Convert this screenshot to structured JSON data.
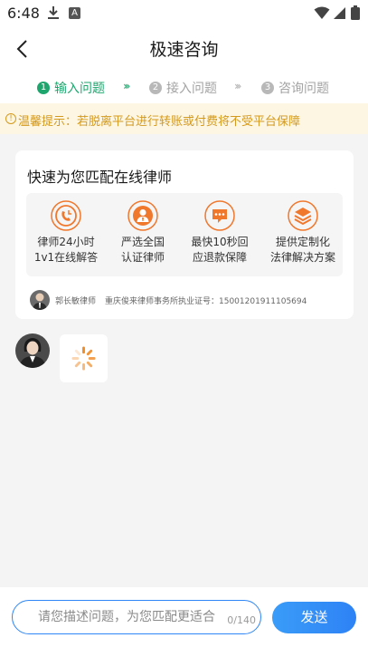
{
  "status_bar": {
    "time": "6:48",
    "notification_letter": "A"
  },
  "nav": {
    "title": "极速咨询"
  },
  "steps": [
    {
      "num": "1",
      "label": "输入问题",
      "state": "active"
    },
    {
      "num": "2",
      "label": "接入问题",
      "state": "inactive"
    },
    {
      "num": "3",
      "label": "咨询问题",
      "state": "inactive"
    }
  ],
  "step_separator": "›››",
  "tip": {
    "icon": "!",
    "text": "温馨提示：若脱离平台进行转账或付费将不受平台保障"
  },
  "card": {
    "title": "快速为您匹配在线律师",
    "features": [
      {
        "icon": "phone-clock-icon",
        "line1": "律师24小时",
        "line2": "1v1在线解答"
      },
      {
        "icon": "certified-lawyer-icon",
        "line1": "严选全国",
        "line2": "认证律师"
      },
      {
        "icon": "refund-icon",
        "line1": "最快10秒回",
        "line2": "应退款保障"
      },
      {
        "icon": "layers-icon",
        "line1": "提供定制化",
        "line2": "法律解决方案"
      }
    ],
    "lawyer": {
      "name": "郭长敏律师",
      "license": "重庆俊来律师事务所执业证号：15001201911105694"
    }
  },
  "composer": {
    "placeholder": "请您描述问题，为您匹配更适合",
    "char_count": "0/140",
    "send_label": "发送"
  },
  "colors": {
    "accent_green": "#1ea66e",
    "accent_orange": "#f0782d",
    "accent_blue": "#2f86f6",
    "tip_yellow": "#d49a1e"
  }
}
